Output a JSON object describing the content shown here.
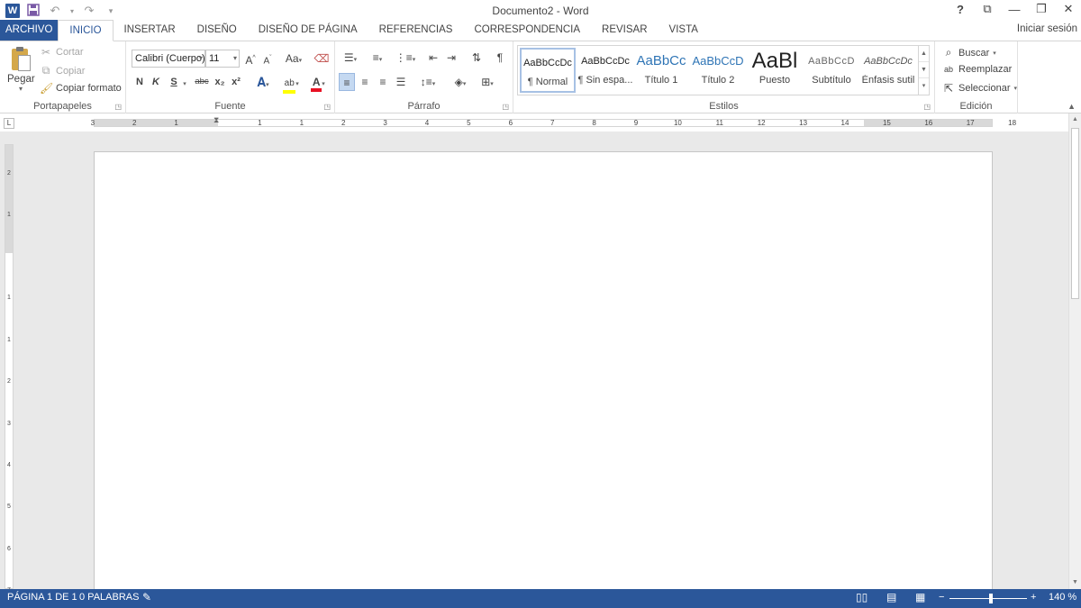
{
  "window": {
    "title": "Documento2 - Word",
    "controls": {
      "help": "?",
      "ribbon_options": "⧉",
      "minimize": "—",
      "restore": "❐",
      "close": "✕"
    }
  },
  "qat": {
    "logo": "W",
    "save_icon": "save-icon",
    "undo_icon": "undo-icon",
    "redo_icon": "redo-icon",
    "customize": "▾"
  },
  "tabs": [
    {
      "label": "ARCHIVO"
    },
    {
      "label": "INICIO"
    },
    {
      "label": "INSERTAR"
    },
    {
      "label": "DISEÑO"
    },
    {
      "label": "DISEÑO DE PÁGINA"
    },
    {
      "label": "REFERENCIAS"
    },
    {
      "label": "CORRESPONDENCIA"
    },
    {
      "label": "REVISAR"
    },
    {
      "label": "VISTA"
    }
  ],
  "signin": "Iniciar sesión",
  "ribbon": {
    "clipboard": {
      "label": "Portapapeles",
      "paste": "Pegar",
      "cut": "Cortar",
      "copy": "Copiar",
      "format_painter": "Copiar formato"
    },
    "font": {
      "label": "Fuente",
      "font_name": "Calibri (Cuerpo)",
      "font_size": "11",
      "bold": "N",
      "italic": "K",
      "underline": "S",
      "strikethrough": "abc",
      "subscript": "x₂",
      "superscript": "x²",
      "change_case": "Aa"
    },
    "paragraph": {
      "label": "Párrafo"
    },
    "styles": {
      "label": "Estilos",
      "items": [
        {
          "sample": "AaBbCcDc",
          "name": "¶ Normal"
        },
        {
          "sample": "AaBbCcDc",
          "name": "¶ Sin espa..."
        },
        {
          "sample": "AaBbCc",
          "name": "Título 1"
        },
        {
          "sample": "AaBbCcD",
          "name": "Título 2"
        },
        {
          "sample": "AaBl",
          "name": "Puesto"
        },
        {
          "sample": "AaBbCcD",
          "name": "Subtítulo"
        },
        {
          "sample": "AaBbCcDc",
          "name": "Énfasis sutil"
        }
      ]
    },
    "editing": {
      "label": "Edición",
      "find": "Buscar",
      "replace": "Reemplazar",
      "select": "Seleccionar"
    }
  },
  "ruler": {
    "h_ticks": [
      "3",
      "2",
      "1",
      "1",
      "1",
      "2",
      "3",
      "4",
      "5",
      "6",
      "7",
      "8",
      "9",
      "10",
      "11",
      "12",
      "13",
      "14",
      "15",
      "16",
      "17",
      "18"
    ],
    "v_ticks": [
      "2",
      "1",
      "1",
      "1",
      "2",
      "3",
      "4",
      "5",
      "6",
      "7"
    ]
  },
  "status": {
    "page": "PÁGINA 1 DE 1",
    "words": "0 PALABRAS",
    "zoom": "140 %",
    "zoom_minus": "−",
    "zoom_plus": "+"
  },
  "colors": {
    "accent": "#2b579a",
    "highlight_yellow": "#ffff00",
    "font_color_red": "#e81123",
    "style_heading_blue": "#2e74b5"
  }
}
